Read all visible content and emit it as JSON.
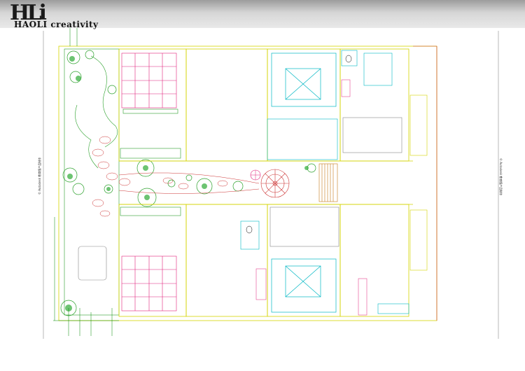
{
  "header": {
    "logo_mark": "HLi",
    "logo_text": "HAOLI creativity"
  },
  "margin_labels": {
    "left": "© Autodesk 教育版产品制作",
    "right": "© Autodesk 教育版产品制作"
  },
  "colors": {
    "wall": "#d4d400",
    "window": "#00b7c4",
    "furniture": "#e0207a",
    "plant": "#2aa02a",
    "annotation": "#008800",
    "outline": "#cc3333"
  }
}
